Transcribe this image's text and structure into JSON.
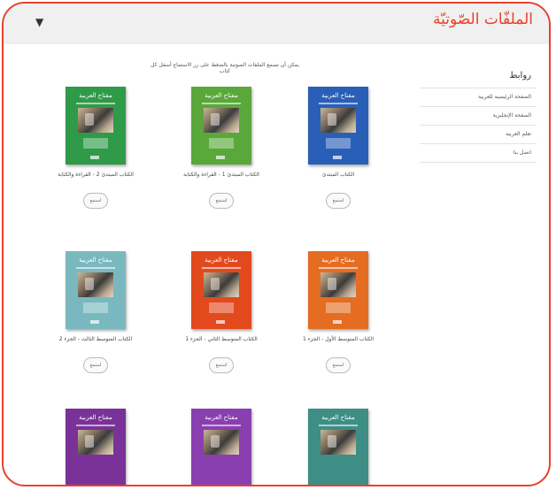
{
  "header": {
    "title": "الملفّات الصّوتيّة",
    "menu_icon": "menu-icon"
  },
  "instruction": "يمكن أن تسمع الملفات الصوتية بالضغط على زر الاستماع أسفل كل كتاب",
  "sidebar": {
    "title": "روابط",
    "items": [
      {
        "label": "الصفحة الرئيسية للعربية"
      },
      {
        "label": "الصفحة الإنجليزية"
      },
      {
        "label": "تعلم العربية"
      },
      {
        "label": "اتصل بنا"
      }
    ]
  },
  "books": [
    {
      "cover_title": "مفتاح العربية",
      "caption": "الكتاب المبتدئ",
      "button": "استمع",
      "color": "#2a5fb8"
    },
    {
      "cover_title": "مفتاح العربية",
      "caption": "الكتاب المبتدئ 1 - القراءة والكتابة",
      "button": "استمع",
      "color": "#5aa83a"
    },
    {
      "cover_title": "مفتاح العربية",
      "caption": "الكتاب المبتدئ 2 - القراءة والكتابة",
      "button": "استمع",
      "color": "#2f9a48"
    },
    {
      "cover_title": "مفتاح العربية",
      "caption": "الكتاب المتوسط الأول - الجزء 1",
      "button": "استمع",
      "color": "#e46d22"
    },
    {
      "cover_title": "مفتاح العربية",
      "caption": "الكتاب المتوسط الثاني - الجزء 1",
      "button": "استمع",
      "color": "#e24a1e"
    },
    {
      "cover_title": "مفتاح العربية",
      "caption": "الكتاب المتوسط الثالث - الجزء 2",
      "button": "استمع",
      "color": "#7ab8c0"
    },
    {
      "cover_title": "مفتاح العربية",
      "caption": "",
      "button": "",
      "color": "#3e8e86"
    },
    {
      "cover_title": "مفتاح العربية",
      "caption": "",
      "button": "",
      "color": "#8a3fb0"
    },
    {
      "cover_title": "مفتاح العربية",
      "caption": "",
      "button": "",
      "color": "#7a3298"
    }
  ]
}
